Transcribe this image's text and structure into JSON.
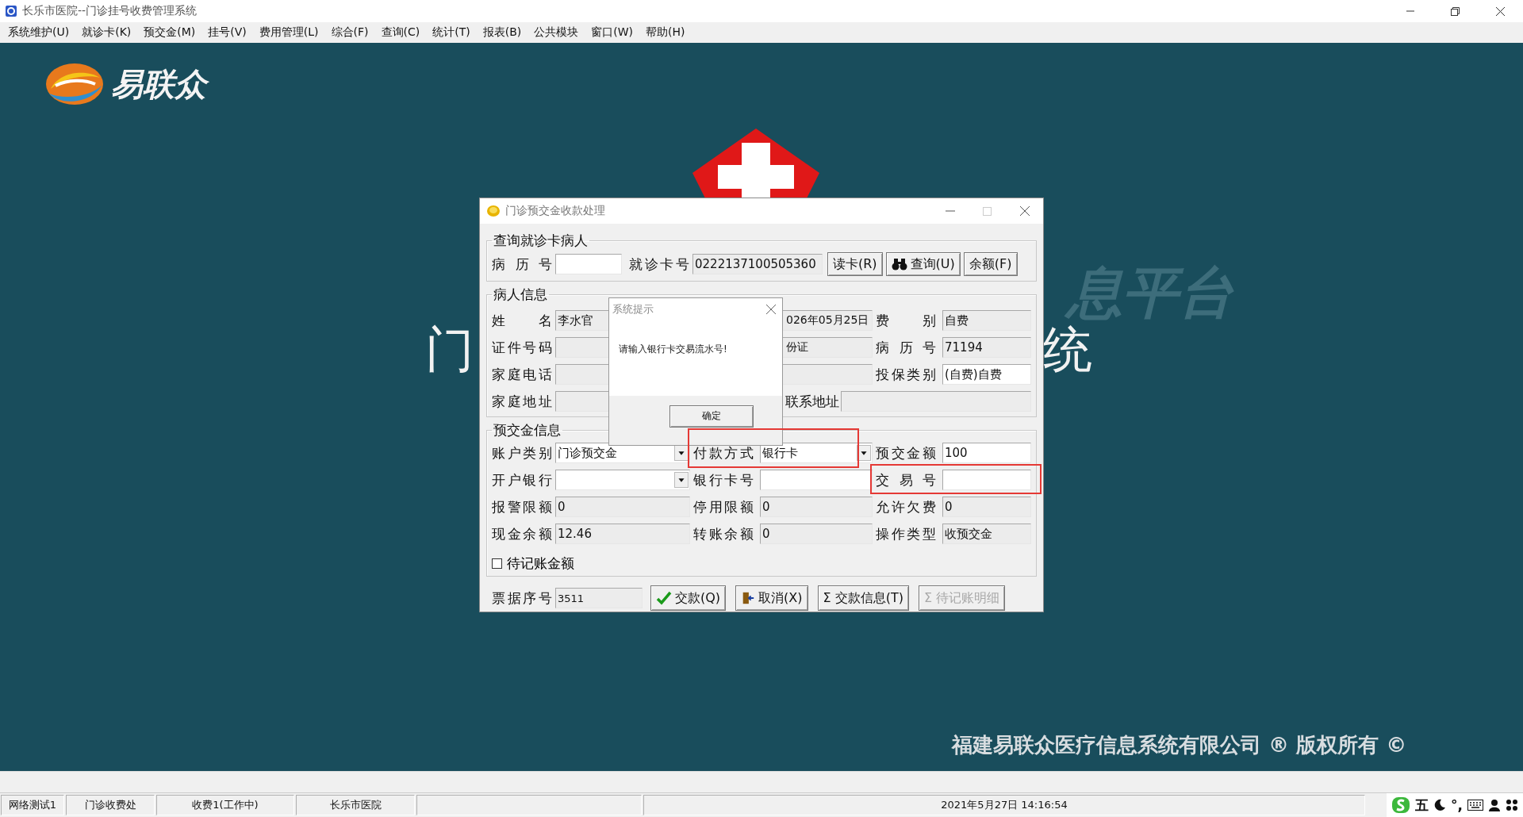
{
  "app": {
    "title": "长乐市医院--门诊挂号收费管理系统"
  },
  "menu": [
    "系统维护(U)",
    "就诊卡(K)",
    "预交金(M)",
    "挂号(V)",
    "费用管理(L)",
    "综合(F)",
    "查询(C)",
    "统计(T)",
    "报表(B)",
    "公共模块",
    "窗口(W)",
    "帮助(H)"
  ],
  "background": {
    "logo_text": "易联众",
    "title_left": "门",
    "title_right": "统",
    "faint_text": "息平台",
    "copyright": "福建易联众医疗信息系统有限公司 ® 版权所有 ©"
  },
  "dialog": {
    "title": "门诊预交金收款处理",
    "query_group": {
      "title": "查询就诊卡病人",
      "fields": [
        {
          "label": "病历号",
          "field": {
            "kind": "text",
            "readonly": false
          }
        },
        {
          "label": "就诊卡号",
          "field": {
            "kind": "text",
            "readonly": true,
            "value": "0222137100505360"
          }
        }
      ],
      "buttons": [
        {
          "label": "读卡(R)",
          "kind": "plain",
          "disabled": false
        },
        {
          "label": "查询(U)",
          "kind": "binoculars",
          "disabled": false
        },
        {
          "label": "余额(F)",
          "kind": "plain",
          "disabled": false
        }
      ]
    },
    "patient_group": {
      "title": "病人信息",
      "rows": [
        [
          {
            "label": "姓名",
            "field": {
              "kind": "text",
              "readonly": true,
              "value": "李水官"
            }
          },
          {
            "field": {
              "kind": "text",
              "readonly": true,
              "value": "026年05月25日"
            }
          },
          {
            "label": "费别",
            "field": {
              "kind": "text",
              "readonly": true,
              "value": "自费"
            }
          }
        ],
        [
          {
            "label": "证件号码",
            "field": {
              "kind": "text",
              "readonly": true
            }
          },
          {
            "field": {
              "kind": "text",
              "readonly": true,
              "value": "份证"
            }
          },
          {
            "label": "病历号",
            "field": {
              "kind": "text",
              "readonly": true,
              "value": "71194"
            }
          }
        ],
        [
          {
            "label": "家庭电话",
            "field": {
              "kind": "text",
              "readonly": true
            }
          },
          {
            "field": {
              "kind": "text",
              "readonly": true
            }
          },
          {
            "label": "投保类别",
            "field": {
              "kind": "text",
              "readonly": false,
              "value": "(自费)自费"
            }
          }
        ],
        [
          {
            "label": "家庭地址",
            "field": {
              "kind": "text",
              "readonly": true
            }
          },
          {
            "label": "联系地址",
            "field": {
              "kind": "text",
              "readonly": true
            }
          }
        ]
      ]
    },
    "prepay_group": {
      "title": "预交金信息",
      "rows": [
        [
          {
            "label": "账户类别",
            "field": {
              "kind": "combo",
              "readonly": false,
              "value": "门诊预交金"
            }
          },
          {
            "label": "付款方式",
            "field": {
              "kind": "combo",
              "readonly": false,
              "value": "银行卡"
            }
          },
          {
            "label": "预交金额",
            "field": {
              "kind": "text",
              "readonly": false,
              "value": "100"
            }
          }
        ],
        [
          {
            "label": "开户银行",
            "field": {
              "kind": "combo",
              "readonly": false
            }
          },
          {
            "label": "银行卡号",
            "field": {
              "kind": "text",
              "readonly": false
            }
          },
          {
            "label": "交易号",
            "field": {
              "kind": "text",
              "readonly": false
            }
          }
        ],
        [
          {
            "label": "报警限额",
            "field": {
              "kind": "text",
              "readonly": true,
              "value": "0"
            }
          },
          {
            "label": "停用限额",
            "field": {
              "kind": "text",
              "readonly": true,
              "value": "0"
            }
          },
          {
            "label": "允许欠费",
            "field": {
              "kind": "text",
              "readonly": true,
              "value": "0"
            }
          }
        ],
        [
          {
            "label": "现金余额",
            "field": {
              "kind": "text",
              "readonly": true,
              "value": "12.46"
            }
          },
          {
            "label": "转账余额",
            "field": {
              "kind": "text",
              "readonly": true,
              "value": "0"
            }
          },
          {
            "label": "操作类型",
            "field": {
              "kind": "text",
              "readonly": true,
              "value": "收预交金"
            }
          }
        ]
      ],
      "checkbox": {
        "label": "待记账金额",
        "checked": false
      }
    },
    "receipt": {
      "label": "票据序号",
      "field": {
        "kind": "text",
        "readonly": true,
        "value": "3511"
      }
    },
    "buttons": [
      {
        "label": "交款(Q)",
        "kind": "check",
        "disabled": false
      },
      {
        "label": "取消(X)",
        "kind": "door",
        "disabled": false
      },
      {
        "label": "Σ 交款信息(T)",
        "kind": "plain",
        "disabled": false
      },
      {
        "label": "Σ 待记账明细",
        "kind": "plain",
        "disabled": true
      }
    ]
  },
  "alert": {
    "title": "系统提示",
    "message": "请输入银行卡交易流水号!",
    "button": "确定"
  },
  "status_bar": {
    "panels": [
      "网络测试1",
      "门诊收费处",
      "收费1(工作中)",
      "长乐市医院"
    ],
    "datetime": "2021年5月27日 14:16:54"
  },
  "tray": {
    "ime_mode": "五",
    "punct": "°,"
  }
}
